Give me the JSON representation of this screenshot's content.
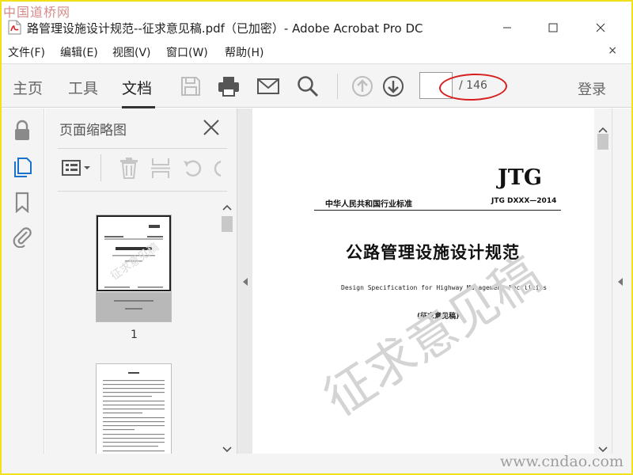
{
  "watermarks": {
    "top_left": "中国道桥网",
    "bottom_right": "www.cndao.com",
    "document_stamp": "征求意见稿"
  },
  "titlebar": {
    "title": "路管理设施设计规范--征求意见稿.pdf（已加密）- Adobe Acrobat Pro DC",
    "min_icon": "minimize-icon",
    "max_icon": "maximize-icon",
    "close_icon": "close-icon"
  },
  "menubar": {
    "items": [
      "文件(F)",
      "编辑(E)",
      "视图(V)",
      "窗口(W)",
      "帮助(H)"
    ],
    "close_glyph": "×"
  },
  "toolbar": {
    "tabs": [
      "主页",
      "工具",
      "文档"
    ],
    "active_tab": "文档",
    "page_current": "",
    "page_total": "/ 146",
    "login": "登录",
    "accent_color": "#d81e1e"
  },
  "thumbnail_panel": {
    "title": "页面缩略图",
    "thumbnails": [
      {
        "label": "1"
      },
      {
        "label": ""
      }
    ]
  },
  "document": {
    "code_logo": "JTG",
    "org": "中华人民共和国行业标准",
    "code": "JTG DXXX—2014",
    "title": "公路管理设施设计规范",
    "subtitle": "Design Specification for Highway Management Facilities",
    "draft_note": "(征求意见稿)"
  }
}
